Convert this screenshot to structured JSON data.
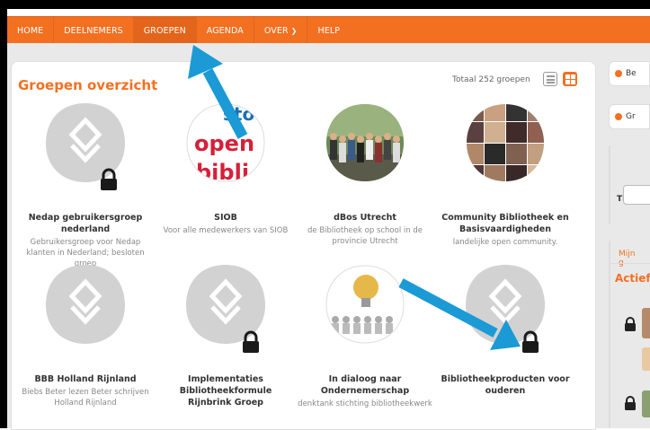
{
  "nav": {
    "items": [
      {
        "label": "HOME"
      },
      {
        "label": "DEELNEMERS"
      },
      {
        "label": "GROEPEN"
      },
      {
        "label": "AGENDA"
      },
      {
        "label": "OVER"
      },
      {
        "label": "HELP"
      }
    ],
    "active": "GROEPEN"
  },
  "page": {
    "title": "Groepen overzicht",
    "total": "Totaal 252 groepen"
  },
  "groups": [
    {
      "name": "Nedap gebruikersgroep nederland",
      "desc": "Gebruikersgroep voor Nedap klanten in Nederland; besloten groep",
      "image": "placeholder",
      "locked": true
    },
    {
      "name": "SIOB",
      "desc": "Voor alle medewerkers van SIOB",
      "image": "siob-logo",
      "locked": false
    },
    {
      "name": "dBos Utrecht",
      "desc": "de Bibliotheek op school in de provincie Utrecht",
      "image": "group-photo",
      "locked": false
    },
    {
      "name": "Community Bibliotheek en Basisvaardigheden",
      "desc": "landelijke open community.",
      "image": "photo-collage",
      "locked": false
    },
    {
      "name": "BBB Holland Rijnland",
      "desc": "Biebs Beter lezen Beter schrijven Holland Rijnland",
      "image": "placeholder",
      "locked": false
    },
    {
      "name": "Implementaties Bibliotheekformule Rijnbrink Groep",
      "desc": "",
      "image": "placeholder",
      "locked": true
    },
    {
      "name": "In dialoog naar Ondernemerschap",
      "desc": "denktank stichting bibliotheekwerk",
      "image": "lightbulb-figures",
      "locked": false
    },
    {
      "name": "Bibliotheekproducten voor ouderen",
      "desc": "",
      "image": "placeholder",
      "locked": true
    }
  ],
  "sidebar": {
    "btn1": "Be",
    "btn2": "Gr",
    "titel": "Titel",
    "tab": "Mijn g",
    "actief": "Actief"
  },
  "colors": {
    "accent": "#f37021",
    "arrow": "#1b9ad6"
  }
}
